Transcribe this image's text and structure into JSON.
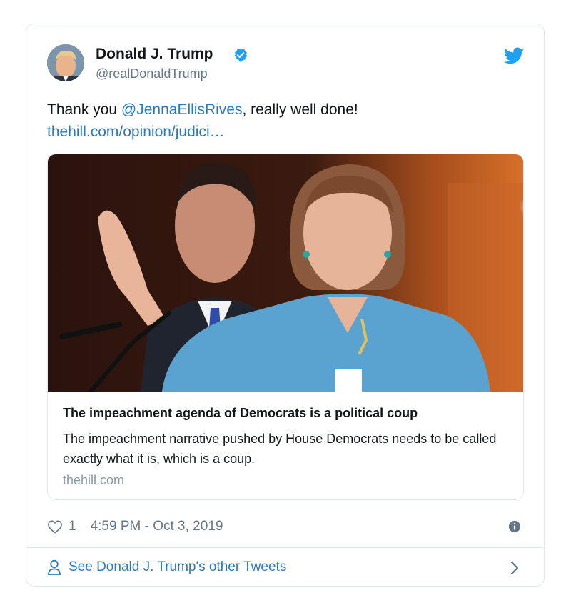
{
  "author": {
    "name": "Donald J. Trump",
    "handle": "@realDonaldTrump",
    "avatar_icon": "profile-photo",
    "verified_icon": "verified-badge-icon"
  },
  "tweet": {
    "text_before": "Thank you ",
    "mention": "@JennaEllisRives",
    "text_after": ", really well done!",
    "link": "thehill.com/opinion/judici…"
  },
  "preview": {
    "title": "The impeachment agenda of Democrats is a political coup",
    "description": "The impeachment narrative pushed by House Democrats needs to be called exactly what it is, which is a coup.",
    "domain": "thehill.com"
  },
  "footer": {
    "likes": "1",
    "timestamp": "4:59 PM - Oct 3, 2019",
    "more_tweets": "See Donald J. Trump's other Tweets"
  },
  "colors": {
    "accent": "#1da1f2",
    "link": "#2b7bb9",
    "muted": "#657786",
    "border": "#e1e8ed"
  }
}
